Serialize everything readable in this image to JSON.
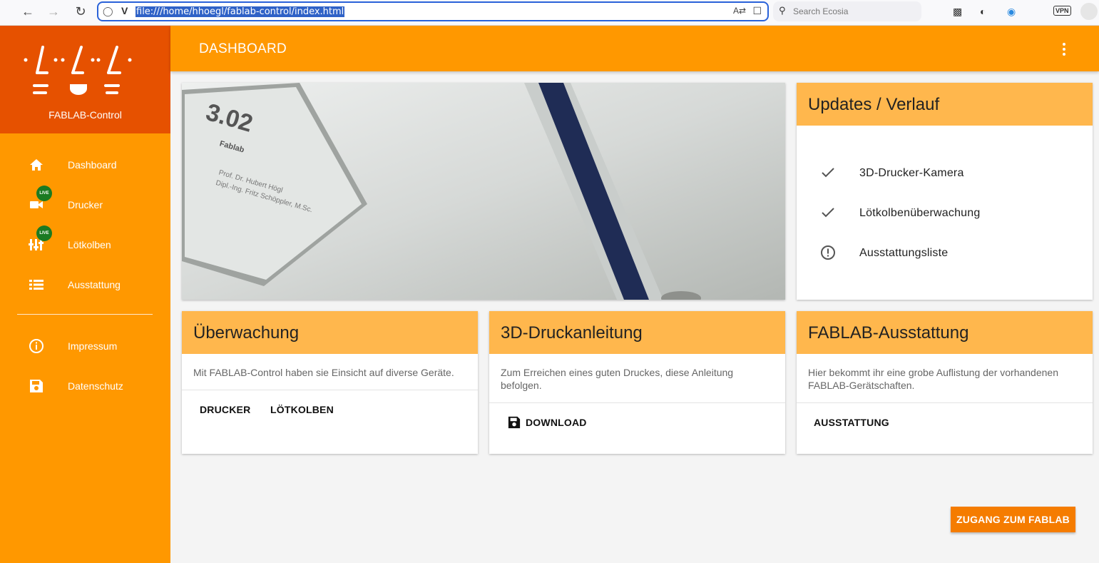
{
  "browser": {
    "url": "file:///home/hhoegl/fablab-control/index.html",
    "search_placeholder": "Search Ecosia",
    "vpn_label": "VPN"
  },
  "sidebar": {
    "brand_name": "FABLAB-Control",
    "items": [
      {
        "label": "Dashboard",
        "icon": "home-icon"
      },
      {
        "label": "Drucker",
        "icon": "videocam-icon",
        "badge": "LIVE"
      },
      {
        "label": "Lötkolben",
        "icon": "equalizer-icon",
        "badge": "LIVE"
      },
      {
        "label": "Ausstattung",
        "icon": "list-icon"
      },
      {
        "label": "Impressum",
        "icon": "info-icon"
      },
      {
        "label": "Datenschutz",
        "icon": "save-icon"
      }
    ]
  },
  "appbar": {
    "title": "DASHBOARD"
  },
  "hero": {
    "sign_number": "3.02",
    "sign_room": "Fablab",
    "sign_line1": "Prof. Dr. Hubert Högl",
    "sign_line2": "Dipl.-Ing. Fritz Schöppler, M.Sc."
  },
  "updates": {
    "title": "Updates / Verlauf",
    "items": [
      {
        "label": "3D-Drucker-Kamera",
        "icon": "check-icon"
      },
      {
        "label": "Lötkolbenüberwachung",
        "icon": "check-icon"
      },
      {
        "label": "Ausstattungsliste",
        "icon": "alert-circle-icon"
      }
    ]
  },
  "cards": {
    "ueberwachung": {
      "title": "Überwachung",
      "text": "Mit FABLAB-Control haben sie Einsicht auf diverse Geräte.",
      "btn1": "DRUCKER",
      "btn2": "LÖTKOLBEN"
    },
    "druckanleitung": {
      "title": "3D-Druckanleitung",
      "text": "Zum Erreichen eines guten Druckes, diese Anleitung befolgen.",
      "btn": "DOWNLOAD"
    },
    "ausstattung": {
      "title": "FABLAB-Ausstattung",
      "text": "Hier bekommt ihr eine grobe Auflistung der vorhandenen FABLAB-Gerätschaften.",
      "btn": "AUSSTATTUNG"
    }
  },
  "cta": {
    "label": "ZUGANG ZUM FABLAB"
  },
  "colors": {
    "primary": "#ff9800",
    "primary_dark": "#e65100",
    "card_header": "#ffb74d",
    "cta": "#f57c00",
    "live_badge": "#1b7a22"
  }
}
